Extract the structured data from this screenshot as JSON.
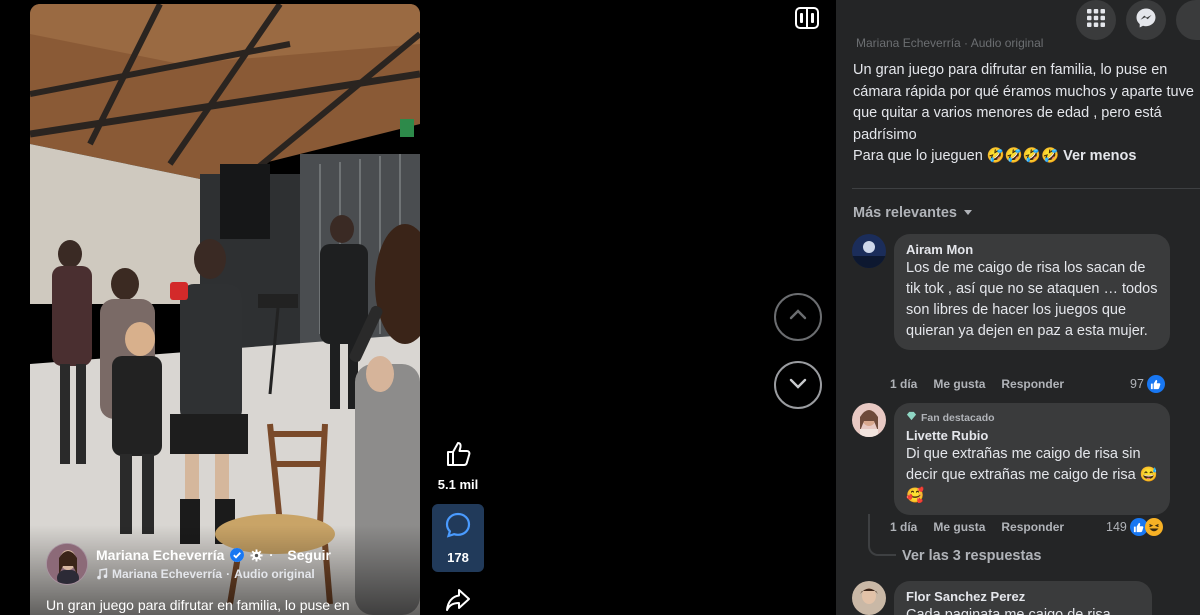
{
  "video": {
    "author": {
      "name": "Mariana Echeverría",
      "follow_label": "Seguir"
    },
    "audio": {
      "artist": "Mariana Echeverría",
      "type": "Audio original"
    },
    "caption": "Un gran juego para difrutar en familia, lo puse en",
    "likes": "5.1 mil",
    "comments": "178"
  },
  "panel": {
    "scrolled_header": "Mariana Echeverría · Audio original",
    "description": "Un gran juego para difrutar en familia, lo puse en cámara rápida por qué éramos muchos y aparte tuve que quitar a varios menores de edad , pero está padrísimo\nPara que lo jueguen 🤣🤣🤣🤣",
    "see_less": "Ver menos",
    "sort_label": "Más relevantes",
    "comments": [
      {
        "name": "Airam Mon",
        "text": "Los de me caigo de risa los sacan de tik tok , así que no se ataquen … todos son libres de hacer los juegos que quieran ya dejen en paz a esta mujer.",
        "time": "1 día",
        "like_label": "Me gusta",
        "reply_label": "Responder",
        "reactions": "97"
      },
      {
        "badge": "Fan destacado",
        "name": "Livette Rubio",
        "text": "Di que extrañas me caigo de risa sin decir que extrañas me caigo de risa 😅🥰",
        "time": "1 día",
        "like_label": "Me gusta",
        "reply_label": "Responder",
        "reactions": "149"
      },
      {
        "name": "Flor Sanchez Perez",
        "text": "Cada paginata me caigo de risa"
      }
    ],
    "view_replies": "Ver las 3 respuestas"
  },
  "colors": {
    "panel_bg": "#242526",
    "bubble_bg": "#3a3b3c",
    "like_blue": "#1877f2",
    "text": "#e4e6eb",
    "muted": "#b0b3b8"
  },
  "icons": [
    "switch-icon",
    "grid-menu-icon",
    "messenger-icon",
    "thumbs-up-icon",
    "comment-icon",
    "share-icon",
    "chevron-up-icon",
    "chevron-down-icon",
    "verified-icon",
    "gear-icon",
    "music-note-icon",
    "caret-down-icon",
    "like-reaction-icon",
    "haha-reaction-icon",
    "diamond-badge-icon"
  ]
}
